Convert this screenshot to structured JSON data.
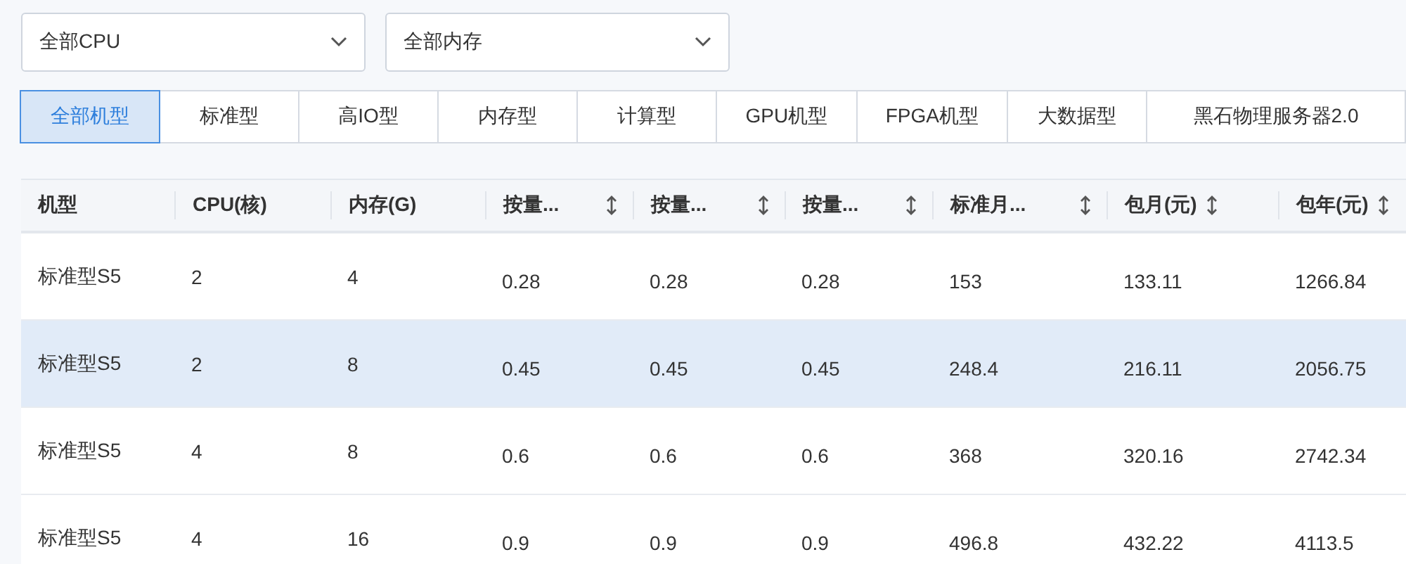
{
  "filters": [
    {
      "value": "全部CPU"
    },
    {
      "value": "全部内存"
    }
  ],
  "tabs": [
    {
      "label": "全部机型",
      "selected": true
    },
    {
      "label": "标准型",
      "selected": false
    },
    {
      "label": "高IO型",
      "selected": false
    },
    {
      "label": "内存型",
      "selected": false
    },
    {
      "label": "计算型",
      "selected": false
    },
    {
      "label": "GPU机型",
      "selected": false
    },
    {
      "label": "FPGA机型",
      "selected": false
    },
    {
      "label": "大数据型",
      "selected": false
    },
    {
      "label": "黑石物理服务器2.0",
      "selected": false
    }
  ],
  "table": {
    "columns": [
      {
        "label": "机型",
        "sortable": false
      },
      {
        "label": "CPU(核)",
        "sortable": false
      },
      {
        "label": "内存(G)",
        "sortable": false
      },
      {
        "label": "按量...",
        "sortable": true
      },
      {
        "label": "按量...",
        "sortable": true
      },
      {
        "label": "按量...",
        "sortable": true
      },
      {
        "label": "标准月...",
        "sortable": true
      },
      {
        "label": "包月(元)",
        "sortable": true
      },
      {
        "label": "包年(元)",
        "sortable": true
      }
    ],
    "rows": [
      {
        "selected": false,
        "cells": [
          "标准型S5",
          "2",
          "4",
          "0.28",
          "0.28",
          "0.28",
          "153",
          "133.11",
          "1266.84"
        ]
      },
      {
        "selected": true,
        "cells": [
          "标准型S5",
          "2",
          "8",
          "0.45",
          "0.45",
          "0.45",
          "248.4",
          "216.11",
          "2056.75"
        ]
      },
      {
        "selected": false,
        "cells": [
          "标准型S5",
          "4",
          "8",
          "0.6",
          "0.6",
          "0.6",
          "368",
          "320.16",
          "2742.34"
        ]
      },
      {
        "selected": false,
        "cells": [
          "标准型S5",
          "4",
          "16",
          "0.9",
          "0.9",
          "0.9",
          "496.8",
          "432.22",
          "4113.5"
        ]
      }
    ]
  }
}
